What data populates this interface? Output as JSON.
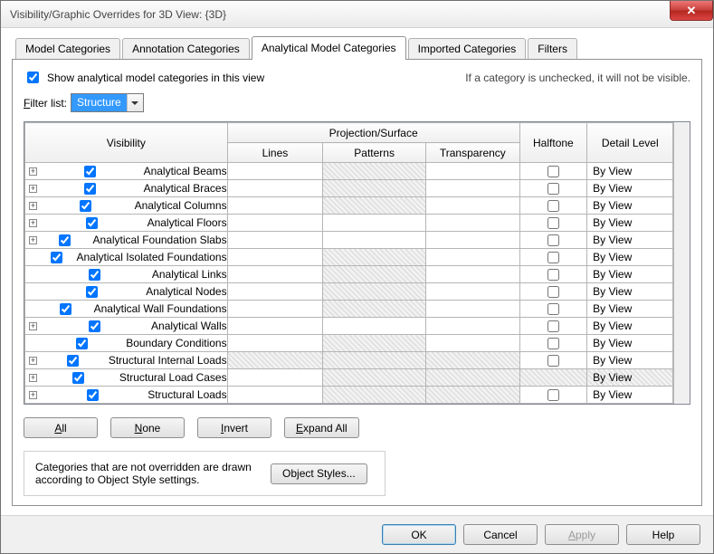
{
  "window": {
    "title": "Visibility/Graphic Overrides for 3D View: {3D}"
  },
  "tabs": {
    "model": "Model Categories",
    "annotation": "Annotation Categories",
    "analytical": "Analytical Model Categories",
    "imported": "Imported Categories",
    "filters": "Filters"
  },
  "panel": {
    "show_label": "Show analytical model categories in this view",
    "note": "If a category is unchecked, it will not be visible.",
    "filter_label_pre": "F",
    "filter_label_post": "ilter list:",
    "filter_value": "Structure"
  },
  "headers": {
    "visibility": "Visibility",
    "projsurf": "Projection/Surface",
    "lines": "Lines",
    "patterns": "Patterns",
    "transparency": "Transparency",
    "halftone": "Halftone",
    "detail": "Detail Level"
  },
  "rows": [
    {
      "expand": true,
      "label": "Analytical Beams",
      "patternsHatch": true,
      "halftone": "unchecked",
      "detail": "By View"
    },
    {
      "expand": true,
      "label": "Analytical Braces",
      "patternsHatch": true,
      "halftone": "unchecked",
      "detail": "By View"
    },
    {
      "expand": true,
      "label": "Analytical Columns",
      "patternsHatch": true,
      "halftone": "unchecked",
      "detail": "By View"
    },
    {
      "expand": true,
      "label": "Analytical Floors",
      "patternsHatch": false,
      "halftone": "unchecked",
      "detail": "By View"
    },
    {
      "expand": true,
      "label": "Analytical Foundation Slabs",
      "patternsHatch": false,
      "halftone": "unchecked",
      "detail": "By View"
    },
    {
      "expand": false,
      "label": "Analytical Isolated Foundations",
      "patternsHatch": true,
      "halftone": "unchecked",
      "detail": "By View"
    },
    {
      "expand": false,
      "label": "Analytical Links",
      "patternsHatch": true,
      "halftone": "unchecked",
      "detail": "By View"
    },
    {
      "expand": false,
      "label": "Analytical Nodes",
      "patternsHatch": true,
      "halftone": "unchecked",
      "detail": "By View"
    },
    {
      "expand": false,
      "label": "Analytical Wall Foundations",
      "patternsHatch": true,
      "halftone": "unchecked",
      "detail": "By View"
    },
    {
      "expand": true,
      "label": "Analytical Walls",
      "patternsHatch": false,
      "halftone": "unchecked",
      "detail": "By View"
    },
    {
      "expand": false,
      "label": "Boundary Conditions",
      "patternsHatch": true,
      "halftone": "unchecked",
      "detail": "By View"
    },
    {
      "expand": true,
      "label": "Structural Internal Loads",
      "patternsHatch": true,
      "linesHatch": true,
      "transHatch": true,
      "halftone": "unchecked",
      "detail": "By View"
    },
    {
      "expand": true,
      "label": "Structural Load Cases",
      "patternsHatch": true,
      "linesHatch": false,
      "transHatch": true,
      "halftone": "hatch",
      "detail": "By View",
      "detailHatch": true
    },
    {
      "expand": true,
      "label": "Structural Loads",
      "patternsHatch": true,
      "linesHatch": false,
      "transHatch": true,
      "halftone": "unchecked",
      "detail": "By View"
    }
  ],
  "buttons": {
    "all_pre": "A",
    "all_post": "ll",
    "all": "All",
    "none_pre": "N",
    "none_post": "one",
    "none": "None",
    "invert_pre": "I",
    "invert_post": "nvert",
    "invert": "Invert",
    "expand_pre": "E",
    "expand_post": "xpand All",
    "expand": "Expand All",
    "obj_styles": "Object Styles...",
    "obj_styles_pre": "Ob",
    "obj_styles_u": "j",
    "obj_styles_post": "ect Styles..."
  },
  "info_text": "Categories that are not overridden are drawn according to Object Style settings.",
  "footer": {
    "ok": "OK",
    "cancel": "Cancel",
    "apply": "Apply",
    "help": "Help"
  }
}
